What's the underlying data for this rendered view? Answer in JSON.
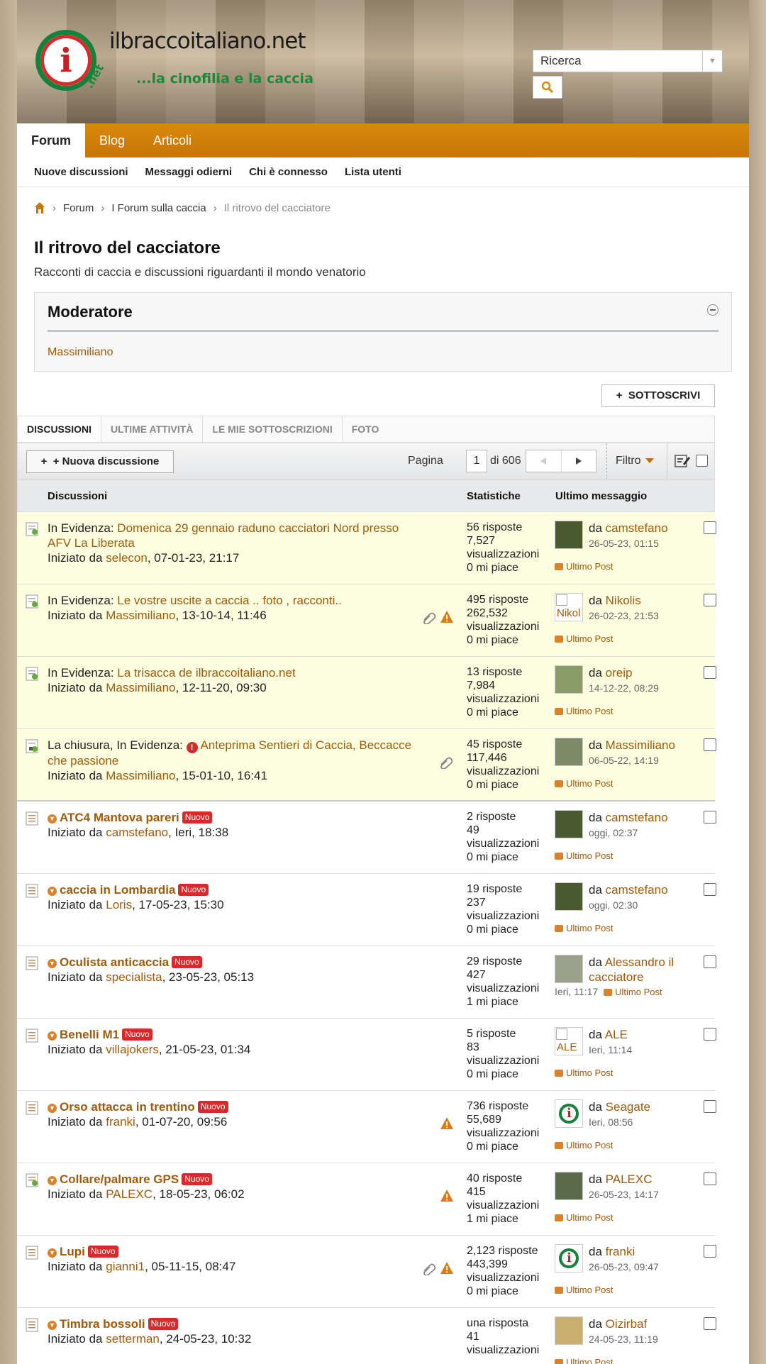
{
  "site": {
    "title": "ilbraccoitaliano.net",
    "tagline": "...la cinofilia e la caccia",
    "logo_letter": "i",
    "logo_suffix": ".net"
  },
  "search": {
    "placeholder": "Ricerca"
  },
  "nav": {
    "tabs": [
      "Forum",
      "Blog",
      "Articoli"
    ]
  },
  "subnav": [
    "Nuove discussioni",
    "Messaggi odierni",
    "Chi è connesso",
    "Lista utenti"
  ],
  "breadcrumb": [
    "Forum",
    "I Forum sulla caccia",
    "Il ritrovo del cacciatore"
  ],
  "page": {
    "title": "Il ritrovo del cacciatore",
    "description": "Racconti di caccia e discussioni riguardanti il mondo venatorio"
  },
  "moderator": {
    "title": "Moderatore",
    "name": "Massimiliano"
  },
  "subscribe_label": "SOTTOSCRIVI",
  "tabs": [
    "DISCUSSIONI",
    "ULTIME ATTIVITÀ",
    "LE MIE SOTTOSCRIZIONI",
    "FOTO"
  ],
  "toolbar": {
    "new_label": "+ Nuova discussione",
    "page_label": "Pagina",
    "page_value": "1",
    "of_label": "di 606",
    "filter_label": "Filtro"
  },
  "columns": {
    "topics": "Discussioni",
    "stats": "Statistiche",
    "last": "Ultimo messaggio"
  },
  "labels": {
    "started_by": "Iniziato da",
    "by": "da",
    "last_post": "Ultimo Post",
    "new_badge": "Nuovo"
  },
  "threads": [
    {
      "prefix": "In Evidenza:",
      "title": "Domenica 29 gennaio raduno cacciatori Nord presso AFV La Liberata",
      "starter": "selecon",
      "date": ", 07-01-23, 21:17",
      "replies": "56 risposte",
      "views": "7,527",
      "views_label": "visualizzazioni",
      "likes": "0 mi piace",
      "last_user": "camstefano",
      "last_time": "26-05-23, 01:15"
    },
    {
      "prefix": "In Evidenza:",
      "title": "Le vostre uscite a caccia .. foto , racconti..",
      "starter": "Massimiliano",
      "date": ", 13-10-14, 11:46",
      "replies": "495 risposte",
      "views": "262,532",
      "views_label": "visualizzazioni",
      "likes": "0 mi piace",
      "last_user": "Nikolis",
      "last_time": "26-02-23, 21:53",
      "avatar_alt": "Nikol"
    },
    {
      "prefix": "In Evidenza:",
      "title": "La trisacca de ilbraccoitaliano.net",
      "starter": "Massimiliano",
      "date": ", 12-11-20, 09:30",
      "replies": "13 risposte",
      "views": "7,984",
      "views_label": "visualizzazioni",
      "likes": "0 mi piace",
      "last_user": "oreip",
      "last_time": "14-12-22, 08:29"
    },
    {
      "prefix": "La chiusura, In Evidenza:",
      "title": "Anteprima Sentieri di Caccia, Beccacce che passione",
      "starter": "Massimiliano",
      "date": ", 15-01-10, 16:41",
      "replies": "45 risposte",
      "views": "117,446",
      "views_label": "visualizzazioni",
      "likes": "0 mi piace",
      "last_user": "Massimiliano",
      "last_time": "06-05-22, 14:19"
    },
    {
      "title": "ATC4 Mantova pareri",
      "starter": "camstefano",
      "date": ", Ieri, 18:38",
      "replies": "2 risposte",
      "views": "49",
      "views_label": "visualizzazioni",
      "likes": "0 mi piace",
      "last_user": "camstefano",
      "last_time": "oggi, 02:37"
    },
    {
      "title": "caccia in Lombardia",
      "starter": "Loris",
      "date": ", 17-05-23, 15:30",
      "replies": "19 risposte",
      "views": "237",
      "views_label": "visualizzazioni",
      "likes": "0 mi piace",
      "last_user": "camstefano",
      "last_time": "oggi, 02:30"
    },
    {
      "title": "Oculista anticaccia",
      "starter": "specialista",
      "date": ", 23-05-23, 05:13",
      "replies": "29 risposte",
      "views": "427",
      "views_label": "visualizzazioni",
      "likes": "1 mi piace",
      "last_user": "Alessandro il cacciatore",
      "last_time": "Ieri, 11:17"
    },
    {
      "title": "Benelli M1",
      "starter": "villajokers",
      "date": ", 21-05-23, 01:34",
      "replies": "5 risposte",
      "views": "83",
      "views_label": "visualizzazioni",
      "likes": "0 mi piace",
      "last_user": "ALE",
      "last_time": "Ieri, 11:14",
      "avatar_alt": "ALE"
    },
    {
      "title": "Orso attacca in trentino",
      "starter": "franki",
      "date": ", 01-07-20, 09:56",
      "replies": "736 risposte",
      "views": "55,689",
      "views_label": "visualizzazioni",
      "likes": "0 mi piace",
      "last_user": "Seagate",
      "last_time": "Ieri, 08:56"
    },
    {
      "title": "Collare/palmare GPS",
      "starter": "PALEXC",
      "date": ", 18-05-23, 06:02",
      "replies": "40 risposte",
      "views": "415",
      "views_label": "visualizzazioni",
      "likes": "1 mi piace",
      "last_user": "PALEXC",
      "last_time": "26-05-23, 14:17"
    },
    {
      "title": "Lupi",
      "starter": "gianni1",
      "date": ", 05-11-15, 08:47",
      "replies": "2,123 risposte",
      "views": "443,399",
      "views_label": "visualizzazioni",
      "likes": "0 mi piace",
      "last_user": "franki",
      "last_time": "26-05-23, 09:47"
    },
    {
      "title": "Timbra bossoli",
      "starter": "setterman",
      "date": ", 24-05-23, 10:32",
      "replies": "una risposta",
      "views": "41",
      "views_label": "visualizzazioni",
      "likes": "",
      "last_user": "Oizirbaf",
      "last_time": "24-05-23, 11:19"
    }
  ],
  "colors": {
    "accent": "#d98a0d",
    "link": "#a05a0a",
    "badge": "#d62b2b",
    "sticky_bg": "#fdfde0"
  }
}
